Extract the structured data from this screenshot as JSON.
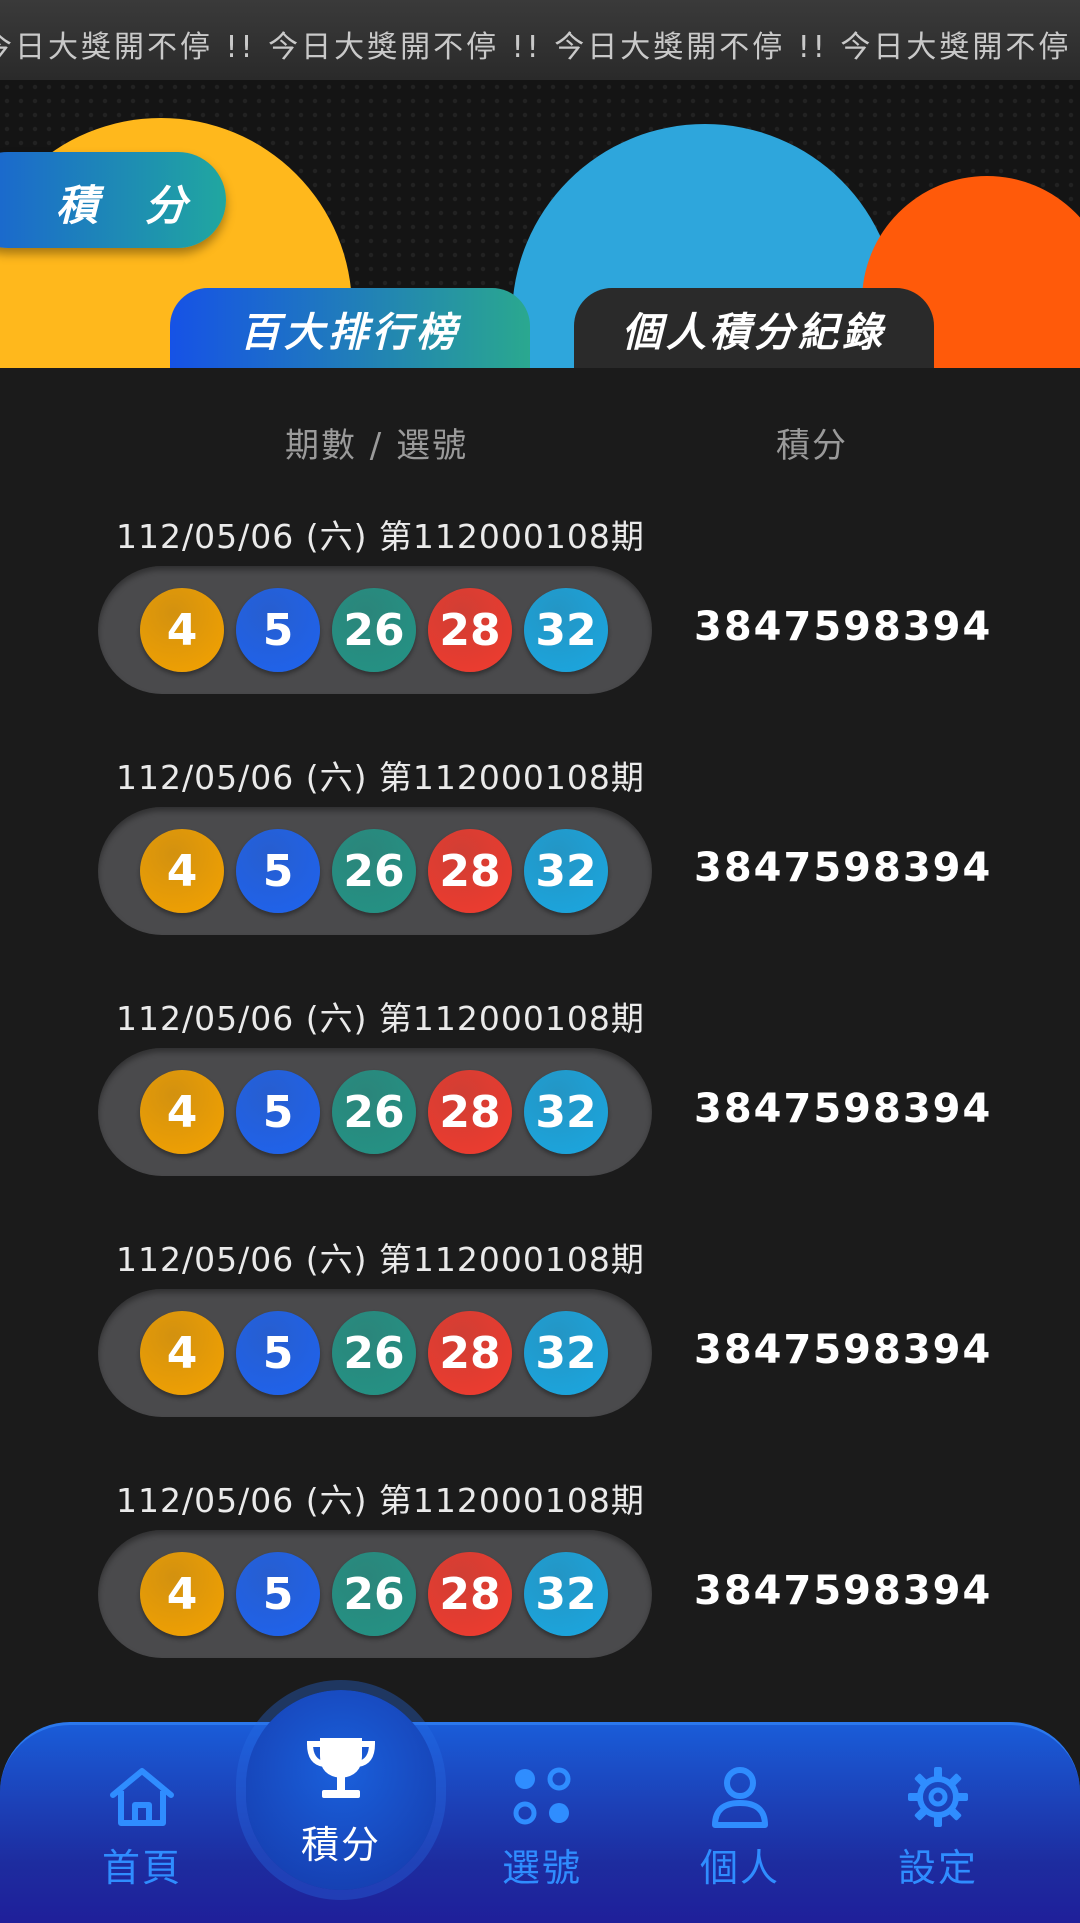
{
  "marquee": {
    "text": "今日大獎開不停 !! 今日大獎開不停 !! 今日大獎開不停 !! 今日大獎開不停 !! 今日大獎開不停 !!"
  },
  "header": {
    "section_title": "積 分",
    "tabs": [
      {
        "label": "百大排行榜",
        "active": false
      },
      {
        "label": "個人積分紀錄",
        "active": true
      }
    ]
  },
  "table": {
    "columns": {
      "period": "期數 / 選號",
      "score": "積分"
    },
    "rows": [
      {
        "label": "112/05/06 (六) 第112000108期",
        "numbers": [
          "4",
          "5",
          "26",
          "28",
          "32"
        ],
        "score": "3847598394"
      },
      {
        "label": "112/05/06 (六) 第112000108期",
        "numbers": [
          "4",
          "5",
          "26",
          "28",
          "32"
        ],
        "score": "3847598394"
      },
      {
        "label": "112/05/06 (六) 第112000108期",
        "numbers": [
          "4",
          "5",
          "26",
          "28",
          "32"
        ],
        "score": "3847598394"
      },
      {
        "label": "112/05/06 (六) 第112000108期",
        "numbers": [
          "4",
          "5",
          "26",
          "28",
          "32"
        ],
        "score": "3847598394"
      },
      {
        "label": "112/05/06 (六) 第112000108期",
        "numbers": [
          "4",
          "5",
          "26",
          "28",
          "32"
        ],
        "score": "3847598394"
      }
    ]
  },
  "ball_colors": [
    "#f5a300",
    "#1e63f0",
    "#239486",
    "#f23b2e",
    "#1aa8e2"
  ],
  "bottom_nav": {
    "items": [
      {
        "label": "首頁",
        "icon": "home-icon"
      },
      {
        "label": "積分",
        "icon": "trophy-icon",
        "active": true
      },
      {
        "label": "選號",
        "icon": "dots-grid-icon"
      },
      {
        "label": "個人",
        "icon": "person-icon"
      },
      {
        "label": "設定",
        "icon": "gear-icon"
      }
    ]
  },
  "colors": {
    "background": "#1b1b1b",
    "accent_blue": "#2f8dff",
    "nav_gradient_top": "#1a5cd8",
    "nav_gradient_bottom": "#1f1f9a"
  }
}
